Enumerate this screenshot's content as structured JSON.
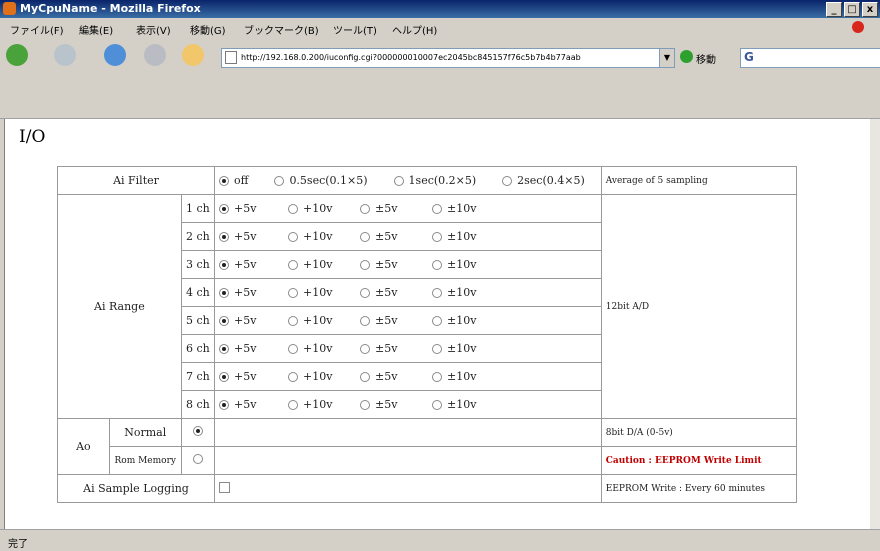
{
  "window": {
    "title": "MyCpuName - Mozilla Firefox",
    "controls": [
      "_",
      "□",
      "x"
    ]
  },
  "menu": [
    "ファイル(F)",
    "編集(E)",
    "表示(V)",
    "移動(G)",
    "ブックマーク(B)",
    "ツール(T)",
    "ヘルプ(H)"
  ],
  "nav": {
    "url": "http://192.168.0.200/iuconfig.cgi?000000010007ec2045bc845157f76c5b7b4b77aab",
    "go_label": "移動",
    "search_placeholder": ""
  },
  "page": {
    "heading": "I/O",
    "ai_filter": {
      "label": "Ai Filter",
      "options": [
        {
          "label": "off",
          "selected": true
        },
        {
          "label": "0.5sec(0.1×5)",
          "selected": false
        },
        {
          "label": "1sec(0.2×5)",
          "selected": false
        },
        {
          "label": "2sec(0.4×5)",
          "selected": false
        }
      ],
      "note": "Average of 5 sampling"
    },
    "ai_range": {
      "label": "Ai Range",
      "note": "12bit A/D",
      "options": [
        "+5v",
        "+10v",
        "±5v",
        "±10v"
      ],
      "selected_index": 0,
      "channels": [
        "1 ch",
        "2 ch",
        "3 ch",
        "4 ch",
        "5 ch",
        "6 ch",
        "7 ch",
        "8 ch"
      ]
    },
    "ao": {
      "label": "Ao",
      "rows": [
        {
          "label": "Normal",
          "selected": true,
          "note": "8bit D/A (0-5v)",
          "caution": false
        },
        {
          "label": "Rom Memory",
          "selected": false,
          "note": "Caution : EEPROM Write Limit",
          "caution": true
        }
      ]
    },
    "ai_logging": {
      "label": "Ai Sample Logging",
      "checked": false,
      "note": "EEPROM Write : Every 60 minutes"
    }
  },
  "status": "完了"
}
